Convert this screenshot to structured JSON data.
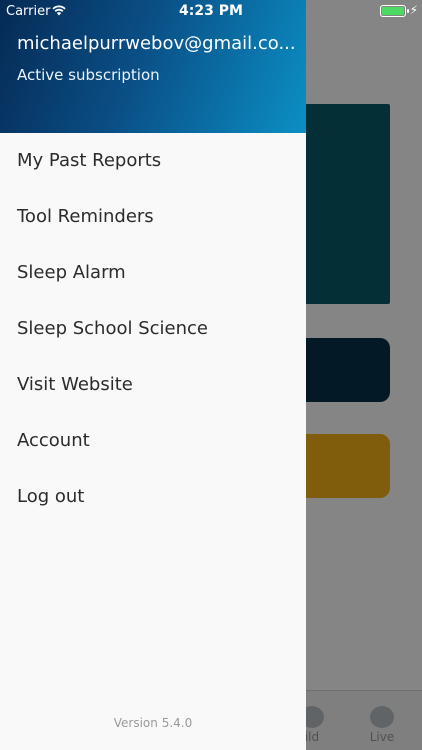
{
  "status_bar": {
    "carrier": "Carrier",
    "time": "4:23 PM"
  },
  "drawer": {
    "email": "michaelpurrwebov@gmail.co...",
    "subscription": "Active subscription",
    "menu_items": [
      "My Past Reports",
      "Tool Reminders",
      "Sleep Alarm",
      "Sleep School Science",
      "Visit Website",
      "Account",
      "Log out"
    ],
    "version": "Version 5.4.0"
  },
  "background": {
    "tabs": [
      "ild",
      "Live"
    ]
  },
  "colors": {
    "header_dark": "#062a55",
    "header_light": "#0b8fc4",
    "card_teal": "#0a5a68",
    "button_dark": "#08314a",
    "button_yellow": "#f3b21a",
    "battery": "#4cd964"
  },
  "icons": [
    "wifi-icon",
    "battery-icon",
    "charging-icon"
  ]
}
